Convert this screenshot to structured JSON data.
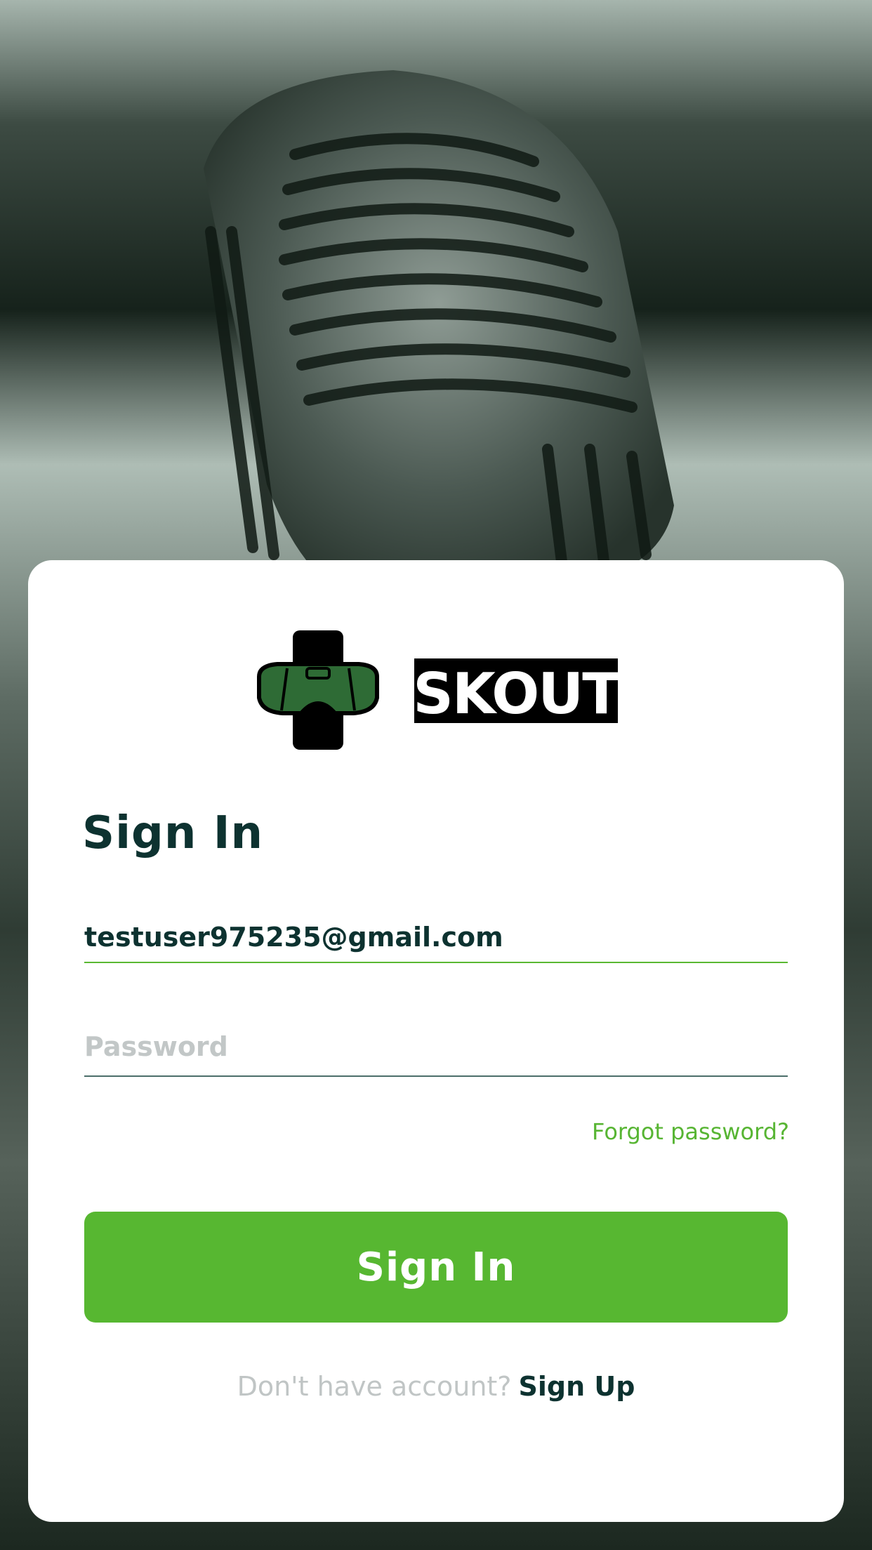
{
  "brand": {
    "name": "SKOUT",
    "logo_icon": "vr-headset-icon",
    "colors": {
      "accent": "#57b731",
      "dark": "#0d3230",
      "headset": "#2e6b35"
    }
  },
  "signin": {
    "title": "Sign In",
    "email_value": "testuser975235@gmail.com",
    "password_placeholder": "Password",
    "forgot_label": "Forgot password?",
    "button_label": "Sign In",
    "signup_prompt": "Don't have account?",
    "signup_label": "Sign Up"
  }
}
